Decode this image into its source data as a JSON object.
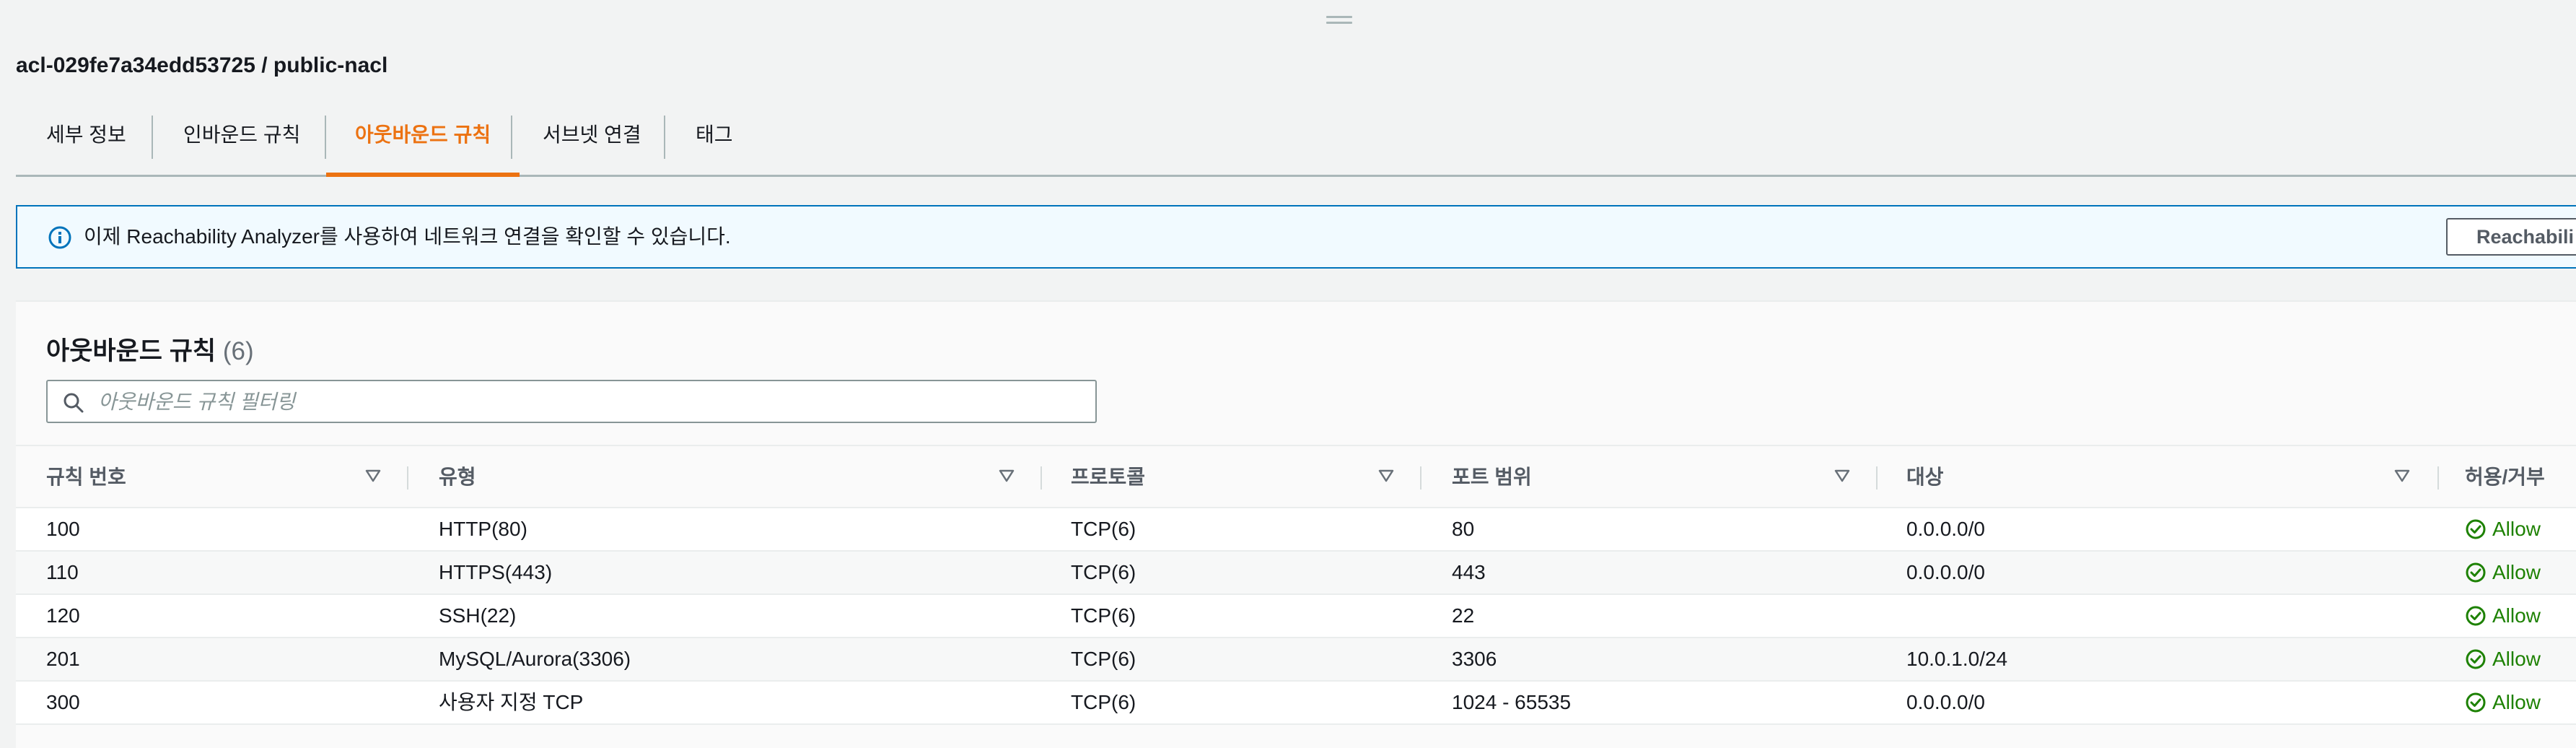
{
  "header": {
    "title": "acl-029fe7a34edd53725 / public-nacl"
  },
  "tabs": [
    {
      "label": "세부 정보",
      "active": false
    },
    {
      "label": "인바운드 규칙",
      "active": false
    },
    {
      "label": "아웃바운드 규칙",
      "active": true
    },
    {
      "label": "서브넷 연결",
      "active": false
    },
    {
      "label": "태그",
      "active": false
    }
  ],
  "banner": {
    "icon": "info-icon",
    "text": "이제 Reachability Analyzer를 사용하여 네트워크 연결을 확인할 수 있습니다.",
    "button_label": "Reachabili"
  },
  "rules_panel": {
    "title": "아웃바운드 규칙",
    "count": "(6)",
    "search_placeholder": "아웃바운드 규칙 필터링",
    "search_value": "",
    "columns": [
      "규칙 번호",
      "유형",
      "프로토콜",
      "포트 범위",
      "대상",
      "허용/거부"
    ],
    "rows": [
      {
        "rule_number": "100",
        "type": "HTTP(80)",
        "protocol": "TCP(6)",
        "port_range": "80",
        "destination": "0.0.0.0/0",
        "action": "Allow"
      },
      {
        "rule_number": "110",
        "type": "HTTPS(443)",
        "protocol": "TCP(6)",
        "port_range": "443",
        "destination": "0.0.0.0/0",
        "action": "Allow"
      },
      {
        "rule_number": "120",
        "type": "SSH(22)",
        "protocol": "TCP(6)",
        "port_range": "22",
        "destination": "",
        "action": "Allow"
      },
      {
        "rule_number": "201",
        "type": "MySQL/Aurora(3306)",
        "protocol": "TCP(6)",
        "port_range": "3306",
        "destination": "10.0.1.0/24",
        "action": "Allow"
      },
      {
        "rule_number": "300",
        "type": "사용자 지정 TCP",
        "protocol": "TCP(6)",
        "port_range": "1024 - 65535",
        "destination": "0.0.0.0/0",
        "action": "Allow"
      }
    ]
  },
  "colors": {
    "accent_active_tab": "#ec7211",
    "info_border": "#0073bb",
    "info_bg": "#f1faff",
    "allow_green": "#1d8102"
  }
}
